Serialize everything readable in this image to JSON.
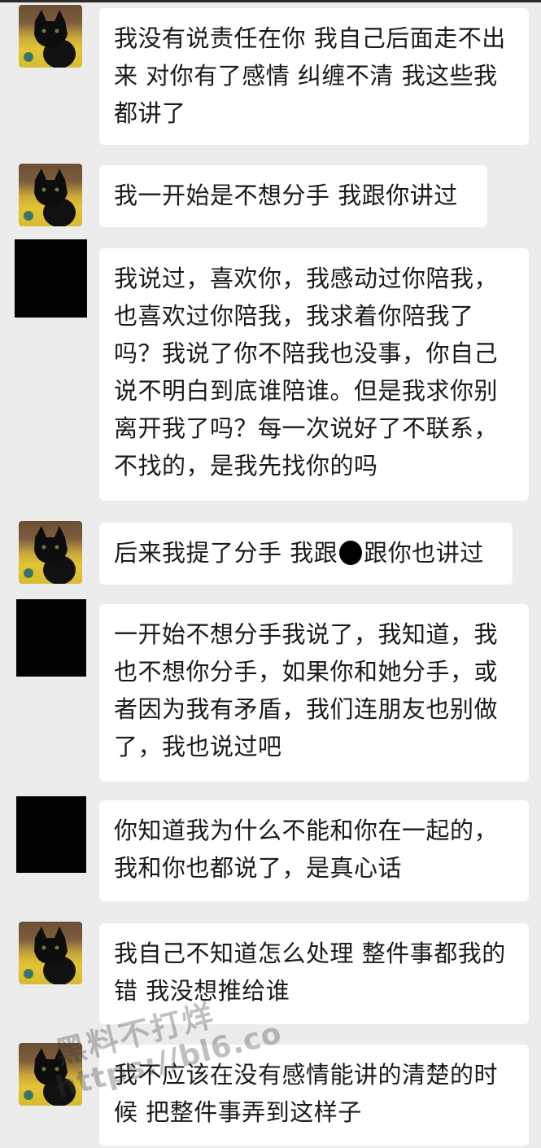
{
  "chat": {
    "messages": [
      {
        "avatar": "cat",
        "text": "我没有说责任在你 我自己后面走不出\n来 对你有了感情 纠缠不清 我这些我\n都讲了"
      },
      {
        "avatar": "cat",
        "text": "我一开始是不想分手 我跟你讲过"
      },
      {
        "avatar": "redacted",
        "text": "我说过，喜欢你，我感动过你陪我，\n也喜欢过你陪我，我求着你陪我了\n吗？我说了你不陪我也没事，你自己\n说不明白到底谁陪谁。但是我求你别\n离开我了吗？每一次说好了不联系，\n不找的，是我先找你的吗"
      },
      {
        "avatar": "cat",
        "text_before": "后来我提了分手 我跟",
        "text_after": "跟你也讲过"
      },
      {
        "avatar": "redacted",
        "text": "一开始不想分手我说了，我知道，我\n也不想你分手，如果你和她分手，或\n者因为我有矛盾，我们连朋友也别做\n了，我也说过吧"
      },
      {
        "avatar": "redacted",
        "text": "你知道我为什么不能和你在一起的，\n我和你也都说了，是真心话"
      },
      {
        "avatar": "cat",
        "text": "我自己不知道怎么处理 整件事都我的\n错 我没想推给谁"
      },
      {
        "avatar": "cat",
        "text": "我不应该在没有感情能讲的清楚的时\n候 把整件事弄到这样子"
      }
    ]
  },
  "watermark": {
    "line1": "黑料不打烊",
    "line2": "https://bl6.co"
  },
  "colors": {
    "background": "#ececec",
    "bubble": "#ffffff",
    "text": "#1a1a1a",
    "redaction": "#000000"
  },
  "icons": {
    "cat_avatar": "black-cat-avatar-icon",
    "redacted_avatar": "redacted-avatar-block"
  }
}
